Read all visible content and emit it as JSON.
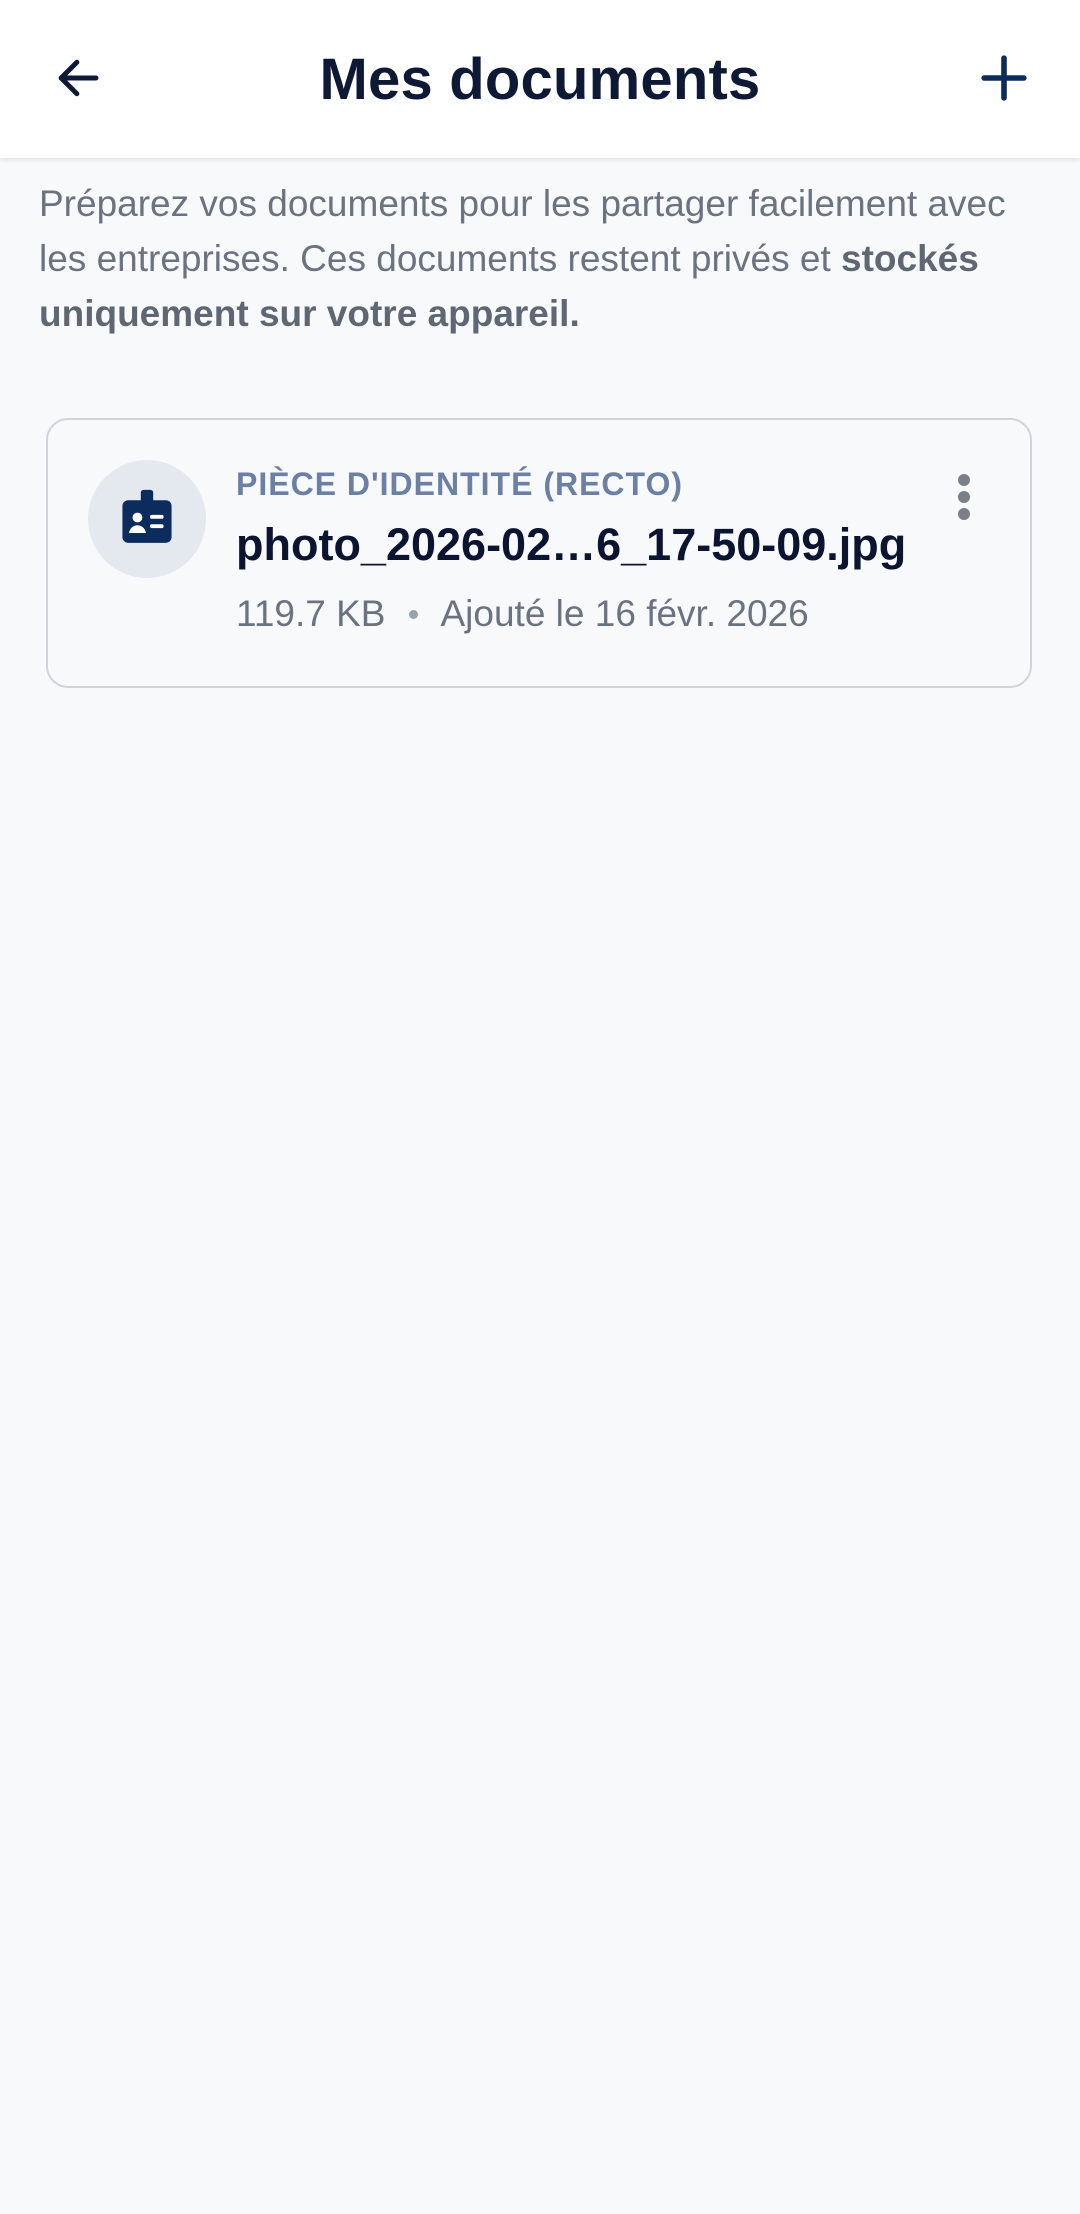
{
  "header": {
    "title": "Mes documents",
    "back_icon": "arrow-left-icon",
    "add_icon": "plus-icon"
  },
  "intro": {
    "text": "Préparez vos documents pour les partager facilement avec les entreprises. Ces documents restent privés et ",
    "bold_text": "stockés uniquement sur votre appareil."
  },
  "documents": [
    {
      "type_label": "PIÈCE D'IDENTITÉ (RECTO)",
      "file_name": "photo_2026-02…6_17-50-09.jpg",
      "size": "119.7 KB",
      "added": "Ajouté le 16 févr. 2026",
      "icon": "id-badge-icon",
      "menu_icon": "more-vertical-icon"
    }
  ],
  "colors": {
    "primary": "#0b2c5c",
    "background": "#f8f9fb",
    "title": "#0e1a35",
    "muted_text": "#6b7280",
    "type_label": "#6c7fa4",
    "card_border": "#d0d3d9",
    "icon_circle": "#e4e8ef"
  }
}
